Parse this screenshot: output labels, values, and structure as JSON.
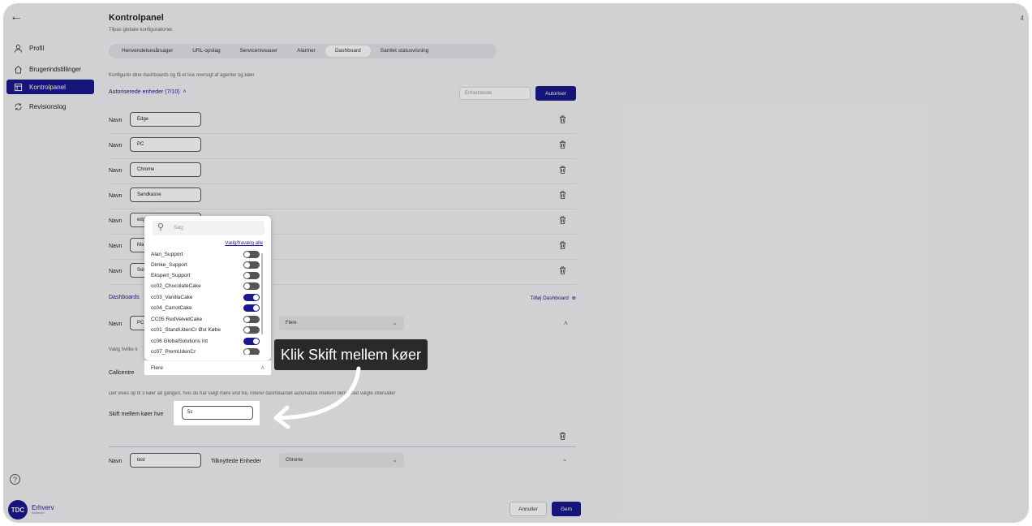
{
  "sidebar": {
    "items": [
      {
        "label": "Profil",
        "icon": "user-icon"
      },
      {
        "label": "Brugerindstillinger",
        "icon": "home-icon"
      },
      {
        "label": "Kontrolpanel",
        "icon": "panel-icon"
      },
      {
        "label": "Revisionslog",
        "icon": "sync-icon"
      }
    ],
    "logo_badge": "TDC",
    "logo_name": "Erhverv",
    "logo_sub": "Scheved"
  },
  "page": {
    "title": "Kontrolpanel",
    "subtitle": "Tilpas globale konfigurationer.",
    "corner_mark": "4",
    "tabs": [
      "Henvendelsesårsager",
      "URL-opslag",
      "Serviceniveauer",
      "Alarmer",
      "Dashboard",
      "Samlet statusvisning"
    ],
    "active_tab": "Dashboard",
    "description": "Konfigurér dine dashboards og få et live oversigt af agenter og køer"
  },
  "devices": {
    "heading": "Autoriserede enheder (7/10)",
    "code_placeholder": "Enhedskode",
    "authorize_label": "Autoriser",
    "name_label": "Navn",
    "items": [
      "Edge",
      "PC",
      "Chrome",
      "Sandkasse",
      "edg",
      "Ma",
      "Sor"
    ]
  },
  "dashboards": {
    "heading": "Dashboards",
    "add_label": "Tilføj Dashboard",
    "name_label": "Navn",
    "first_name": "PC",
    "devices_select": "Flere",
    "queues_hint": "Vælg hvilke k",
    "callcentre_label": "Callcentre",
    "callcentre_select": "Flere",
    "info_text": "Der vises op til 3 køer ad gangen, hvis du har valgt mere end tre, roterer dashboardet automatisk imellem dem, med valgte intervaller",
    "switch_label": "Skift mellem køer hve",
    "switch_value": "5s",
    "second_name": "test",
    "linked_label": "Tilknyttede Enheder",
    "linked_value": "Chrome"
  },
  "dropdown": {
    "search_placeholder": "Søg",
    "select_all": "Vælg/fravælg alle",
    "items": [
      {
        "label": "Alan_Support",
        "on": false
      },
      {
        "label": "Dimke_Support",
        "on": false
      },
      {
        "label": "Ekspert_Support",
        "on": false
      },
      {
        "label": "cc02_ChocolateCake",
        "on": false
      },
      {
        "label": "cc03_VanillaCake",
        "on": true
      },
      {
        "label": "cc04_CarrotCake",
        "on": true
      },
      {
        "label": "CC05 RedVelvetCake",
        "on": false
      },
      {
        "label": "cc01_StandUdenCr Øst Købe",
        "on": false
      },
      {
        "label": "cc06 GlobalSolutions Int",
        "on": true
      },
      {
        "label": "cc07_PremUdenCr",
        "on": false
      }
    ]
  },
  "footer": {
    "cancel_label": "Annuller",
    "save_label": "Gem"
  },
  "tutorial": {
    "callout_text": "Klik Skift mellem køer"
  },
  "colors": {
    "brand": "#1a1a8e",
    "callout_bg": "#2a2a2a"
  }
}
